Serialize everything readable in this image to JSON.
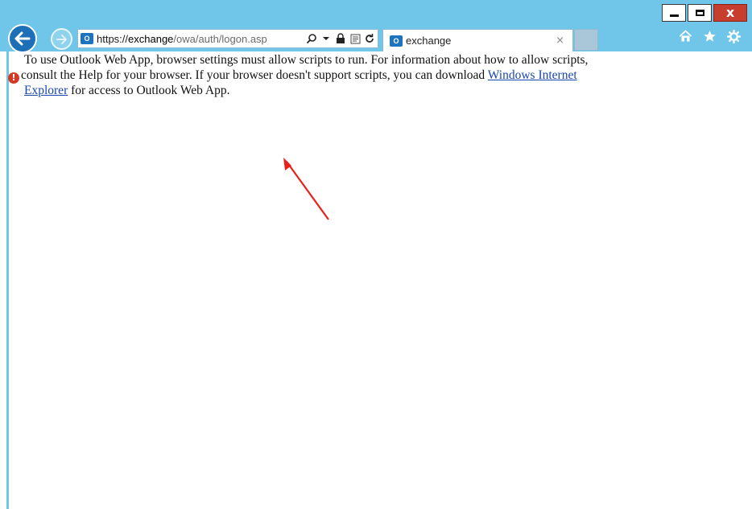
{
  "window": {
    "minimize_glyph": "minimize-icon",
    "maximize_glyph": "maximize-icon",
    "close_label": "x"
  },
  "nav": {
    "back_icon": "back-arrow-icon",
    "forward_icon": "forward-arrow-icon"
  },
  "address": {
    "favicon_label": "O",
    "url_scheme": "https://",
    "url_host": "exchange",
    "url_path": "/owa/auth/logon.asp"
  },
  "tab": {
    "favicon_label": "O",
    "title": "exchange",
    "close_label": "×"
  },
  "message": {
    "line1": "To use Outlook Web App, browser settings must allow scripts to run. For information about how to allow scripts,",
    "line2_text": "consult the Help for your browser. If your browser doesn't support scripts, you can download ",
    "link_part1": "Windows Internet",
    "link_part2": "Explorer",
    "line3_text": " for access to Outlook Web App.",
    "error_icon_glyph": "!"
  },
  "colors": {
    "chrome": "#6fc6e8",
    "link": "#1a46b0",
    "annotation_arrow": "#e8211c"
  }
}
